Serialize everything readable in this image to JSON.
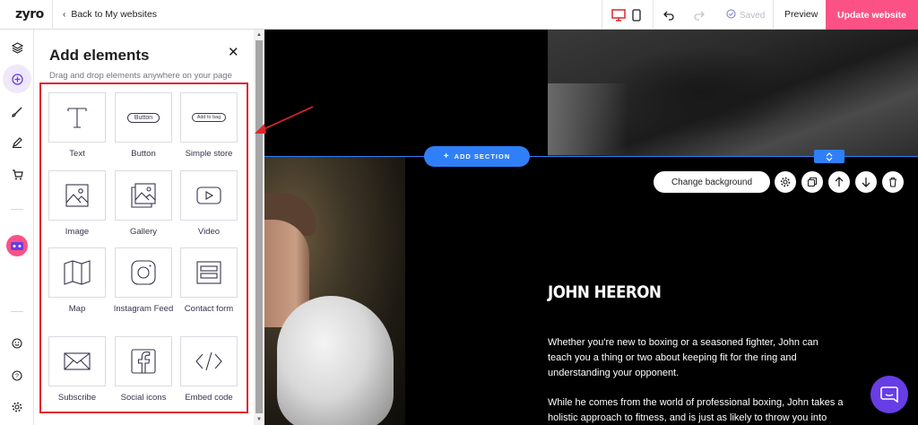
{
  "topbar": {
    "logo": "zyro",
    "back_label": "Back to My websites",
    "saved_label": "Saved",
    "preview_label": "Preview",
    "update_label": "Update website"
  },
  "panel": {
    "title": "Add elements",
    "subtitle": "Drag and drop elements anywhere on your page",
    "elements": [
      {
        "label": "Text",
        "icon": "text-icon"
      },
      {
        "label": "Button",
        "icon": "button-icon",
        "preview": "Button"
      },
      {
        "label": "Simple store",
        "icon": "store-icon",
        "preview": "Add to bag"
      },
      {
        "label": "Image",
        "icon": "image-icon"
      },
      {
        "label": "Gallery",
        "icon": "gallery-icon"
      },
      {
        "label": "Video",
        "icon": "video-icon"
      },
      {
        "label": "Map",
        "icon": "map-icon"
      },
      {
        "label": "Instagram Feed",
        "icon": "instagram-icon"
      },
      {
        "label": "Contact form",
        "icon": "form-icon"
      },
      {
        "label": "Subscribe",
        "icon": "envelope-icon"
      },
      {
        "label": "Social icons",
        "icon": "facebook-icon"
      },
      {
        "label": "Embed code",
        "icon": "code-icon"
      }
    ]
  },
  "canvas": {
    "add_section_label": "ADD SECTION",
    "change_bg_label": "Change background",
    "heading": "JOHN HEERON",
    "para1": "Whether you're new to boxing or a seasoned fighter, John can teach you a thing or two about keeping fit for the ring and understanding your opponent.",
    "para2": "While he comes from the world of professional boxing, John takes a holistic approach to fitness, and is just as likely to throw you into"
  },
  "colors": {
    "accent": "#673de6",
    "update": "#fc5185",
    "selection": "#2f7ff8",
    "highlight": "#e0252d"
  }
}
